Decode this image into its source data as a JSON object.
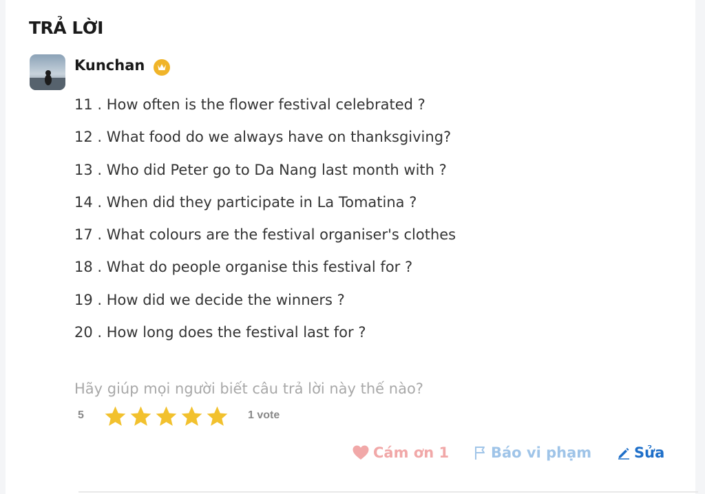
{
  "section": {
    "title": "TRẢ LỜI"
  },
  "answer": {
    "author": "Kunchan",
    "lines": [
      "11 . How often is the flower festival celebrated ?",
      "12 . What food do we always have on thanksgiving?",
      "13 . Who did Peter go to Da Nang last month with ?",
      "14 . When did they participate in La Tomatina ?",
      "17 . What colours are the festival organiser's clothes",
      "18 . What do people organise this festival for ?",
      "19 . How did we decide the winners ?",
      "20 . How long does the festival last for ?"
    ]
  },
  "rating": {
    "prompt": "Hãy giúp mọi người biết câu trả lời này thế nào?",
    "score": "5",
    "stars": 5,
    "votes": "1 vote"
  },
  "actions": {
    "thanks_label": "Cám ơn 1",
    "report_label": "Báo vi phạm",
    "edit_label": "Sửa"
  },
  "colors": {
    "star": "#f2c12e",
    "badge": "#f0b429",
    "thanks": "#f1a8a8",
    "report": "#9fc4e8",
    "edit": "#1e6fc9"
  },
  "icons": [
    "avatar",
    "verified-badge-icon",
    "star-icon",
    "heart-icon",
    "flag-icon",
    "pencil-icon"
  ]
}
